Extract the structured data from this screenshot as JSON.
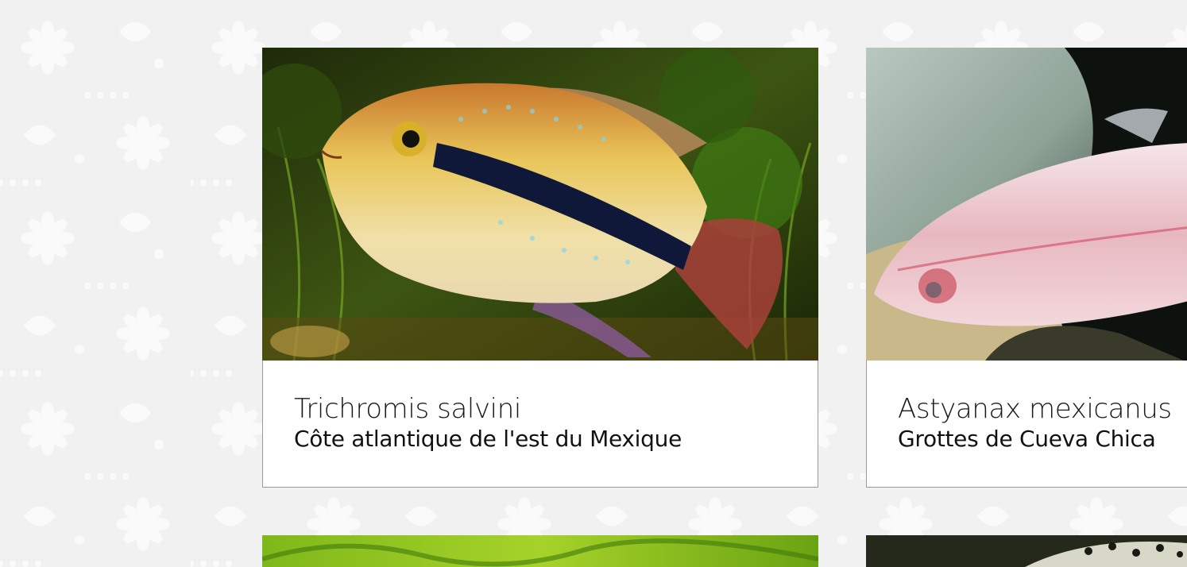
{
  "cards": [
    {
      "species": "Trichromis salvini",
      "origin": "Côte atlantique de l'est du Mexique",
      "photo_icon": "cichlid-fish-photo"
    },
    {
      "species": "Astyanax mexicanus",
      "origin": "Grottes de Cueva Chica",
      "photo_icon": "blind-cave-fish-photo"
    }
  ],
  "colors": {
    "background": "#f1f1f1",
    "pattern": "#ffffff",
    "card_border": "#9a9a9a"
  }
}
